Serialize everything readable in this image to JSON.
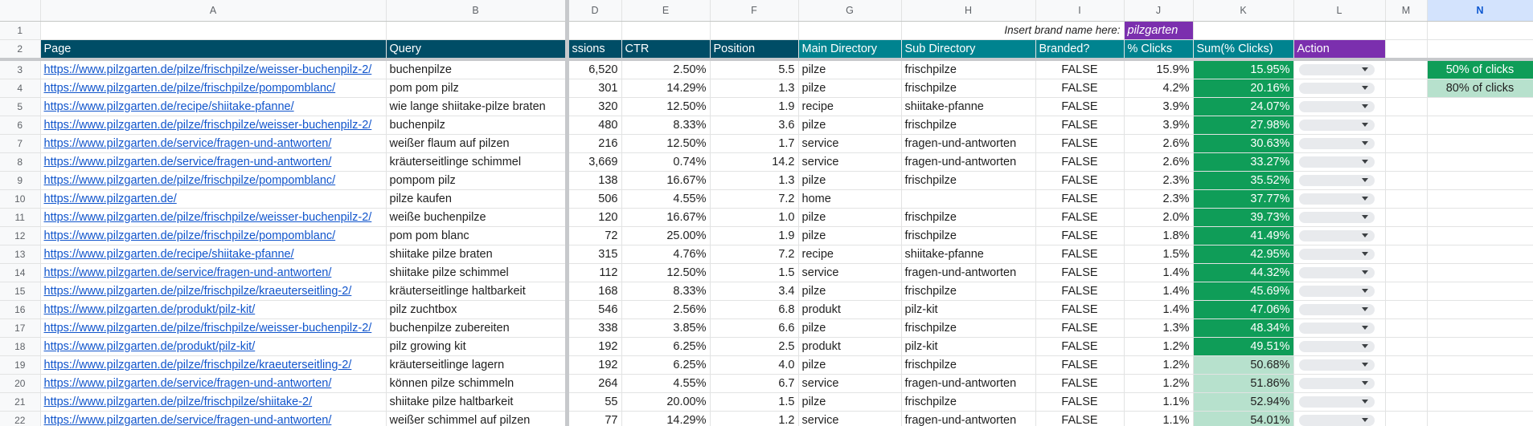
{
  "columns": [
    "",
    "A",
    "B",
    "D",
    "E",
    "F",
    "G",
    "H",
    "I",
    "J",
    "K",
    "L",
    "M",
    "N"
  ],
  "selected_column": "N",
  "row1": {
    "row_number": "1",
    "brand_prompt": "Insert brand name here:",
    "brand_value": "pilzgarten"
  },
  "headers": {
    "row_number": "2",
    "page": "Page",
    "query": "Query",
    "impressions": "ssions",
    "ctr": "CTR",
    "position": "Position",
    "main_directory": "Main Directory",
    "sub_directory": "Sub Directory",
    "branded": "Branded?",
    "pct_clicks": "% Clicks",
    "sum_clicks": "Sum(% Clicks)",
    "action": "Action"
  },
  "legend": {
    "dark_label": "50% of clicks",
    "light_label": "80% of clicks",
    "dark_color": "#0f9d58",
    "light_color": "#b7e1cd"
  },
  "rows": [
    {
      "n": "3",
      "page": "https://www.pilzgarten.de/pilze/frischpilze/weisser-buchenpilz-2/",
      "query": "buchenpilze",
      "impressions": "6,520",
      "ctr": "2.50%",
      "position": "5.5",
      "main": "pilze",
      "sub": "frischpilze",
      "branded": "FALSE",
      "pct": "15.9%",
      "sum": "15.95%",
      "tier": "dark"
    },
    {
      "n": "4",
      "page": "https://www.pilzgarten.de/pilze/frischpilze/pompomblanc/",
      "query": "pom pom pilz",
      "impressions": "301",
      "ctr": "14.29%",
      "position": "1.3",
      "main": "pilze",
      "sub": "frischpilze",
      "branded": "FALSE",
      "pct": "4.2%",
      "sum": "20.16%",
      "tier": "dark"
    },
    {
      "n": "5",
      "page": "https://www.pilzgarten.de/recipe/shiitake-pfanne/",
      "query": "wie lange shiitake-pilze braten",
      "impressions": "320",
      "ctr": "12.50%",
      "position": "1.9",
      "main": "recipe",
      "sub": "shiitake-pfanne",
      "branded": "FALSE",
      "pct": "3.9%",
      "sum": "24.07%",
      "tier": "dark"
    },
    {
      "n": "6",
      "page": "https://www.pilzgarten.de/pilze/frischpilze/weisser-buchenpilz-2/",
      "query": "buchenpilz",
      "impressions": "480",
      "ctr": "8.33%",
      "position": "3.6",
      "main": "pilze",
      "sub": "frischpilze",
      "branded": "FALSE",
      "pct": "3.9%",
      "sum": "27.98%",
      "tier": "dark"
    },
    {
      "n": "7",
      "page": "https://www.pilzgarten.de/service/fragen-und-antworten/",
      "query": "weißer flaum auf pilzen",
      "impressions": "216",
      "ctr": "12.50%",
      "position": "1.7",
      "main": "service",
      "sub": "fragen-und-antworten",
      "branded": "FALSE",
      "pct": "2.6%",
      "sum": "30.63%",
      "tier": "dark"
    },
    {
      "n": "8",
      "page": "https://www.pilzgarten.de/service/fragen-und-antworten/",
      "query": "kräuterseitlinge schimmel",
      "impressions": "3,669",
      "ctr": "0.74%",
      "position": "14.2",
      "main": "service",
      "sub": "fragen-und-antworten",
      "branded": "FALSE",
      "pct": "2.6%",
      "sum": "33.27%",
      "tier": "dark"
    },
    {
      "n": "9",
      "page": "https://www.pilzgarten.de/pilze/frischpilze/pompomblanc/",
      "query": "pompom pilz",
      "impressions": "138",
      "ctr": "16.67%",
      "position": "1.3",
      "main": "pilze",
      "sub": "frischpilze",
      "branded": "FALSE",
      "pct": "2.3%",
      "sum": "35.52%",
      "tier": "dark"
    },
    {
      "n": "10",
      "page": "https://www.pilzgarten.de/",
      "query": "pilze kaufen",
      "impressions": "506",
      "ctr": "4.55%",
      "position": "7.2",
      "main": "home",
      "sub": "",
      "branded": "FALSE",
      "pct": "2.3%",
      "sum": "37.77%",
      "tier": "dark"
    },
    {
      "n": "11",
      "page": "https://www.pilzgarten.de/pilze/frischpilze/weisser-buchenpilz-2/",
      "query": "weiße buchenpilze",
      "impressions": "120",
      "ctr": "16.67%",
      "position": "1.0",
      "main": "pilze",
      "sub": "frischpilze",
      "branded": "FALSE",
      "pct": "2.0%",
      "sum": "39.73%",
      "tier": "dark"
    },
    {
      "n": "12",
      "page": "https://www.pilzgarten.de/pilze/frischpilze/pompomblanc/",
      "query": "pom pom blanc",
      "impressions": "72",
      "ctr": "25.00%",
      "position": "1.9",
      "main": "pilze",
      "sub": "frischpilze",
      "branded": "FALSE",
      "pct": "1.8%",
      "sum": "41.49%",
      "tier": "dark"
    },
    {
      "n": "13",
      "page": "https://www.pilzgarten.de/recipe/shiitake-pfanne/",
      "query": "shiitake pilze braten",
      "impressions": "315",
      "ctr": "4.76%",
      "position": "7.2",
      "main": "recipe",
      "sub": "shiitake-pfanne",
      "branded": "FALSE",
      "pct": "1.5%",
      "sum": "42.95%",
      "tier": "dark"
    },
    {
      "n": "14",
      "page": "https://www.pilzgarten.de/service/fragen-und-antworten/",
      "query": "shiitake pilze schimmel",
      "impressions": "112",
      "ctr": "12.50%",
      "position": "1.5",
      "main": "service",
      "sub": "fragen-und-antworten",
      "branded": "FALSE",
      "pct": "1.4%",
      "sum": "44.32%",
      "tier": "dark"
    },
    {
      "n": "15",
      "page": "https://www.pilzgarten.de/pilze/frischpilze/kraeuterseitling-2/",
      "query": "kräuterseitlinge haltbarkeit",
      "impressions": "168",
      "ctr": "8.33%",
      "position": "3.4",
      "main": "pilze",
      "sub": "frischpilze",
      "branded": "FALSE",
      "pct": "1.4%",
      "sum": "45.69%",
      "tier": "dark"
    },
    {
      "n": "16",
      "page": "https://www.pilzgarten.de/produkt/pilz-kit/",
      "query": "pilz zuchtbox",
      "impressions": "546",
      "ctr": "2.56%",
      "position": "6.8",
      "main": "produkt",
      "sub": "pilz-kit",
      "branded": "FALSE",
      "pct": "1.4%",
      "sum": "47.06%",
      "tier": "dark"
    },
    {
      "n": "17",
      "page": "https://www.pilzgarten.de/pilze/frischpilze/weisser-buchenpilz-2/",
      "query": "buchenpilze zubereiten",
      "impressions": "338",
      "ctr": "3.85%",
      "position": "6.6",
      "main": "pilze",
      "sub": "frischpilze",
      "branded": "FALSE",
      "pct": "1.3%",
      "sum": "48.34%",
      "tier": "dark"
    },
    {
      "n": "18",
      "page": "https://www.pilzgarten.de/produkt/pilz-kit/",
      "query": "pilz growing kit",
      "impressions": "192",
      "ctr": "6.25%",
      "position": "2.5",
      "main": "produkt",
      "sub": "pilz-kit",
      "branded": "FALSE",
      "pct": "1.2%",
      "sum": "49.51%",
      "tier": "dark"
    },
    {
      "n": "19",
      "page": "https://www.pilzgarten.de/pilze/frischpilze/kraeuterseitling-2/",
      "query": "kräuterseitlinge lagern",
      "impressions": "192",
      "ctr": "6.25%",
      "position": "4.0",
      "main": "pilze",
      "sub": "frischpilze",
      "branded": "FALSE",
      "pct": "1.2%",
      "sum": "50.68%",
      "tier": "light"
    },
    {
      "n": "20",
      "page": "https://www.pilzgarten.de/service/fragen-und-antworten/",
      "query": "können pilze schimmeln",
      "impressions": "264",
      "ctr": "4.55%",
      "position": "6.7",
      "main": "service",
      "sub": "fragen-und-antworten",
      "branded": "FALSE",
      "pct": "1.2%",
      "sum": "51.86%",
      "tier": "light"
    },
    {
      "n": "21",
      "page": "https://www.pilzgarten.de/pilze/frischpilze/shiitake-2/",
      "query": "shiitake pilze haltbarkeit",
      "impressions": "55",
      "ctr": "20.00%",
      "position": "1.5",
      "main": "pilze",
      "sub": "frischpilze",
      "branded": "FALSE",
      "pct": "1.1%",
      "sum": "52.94%",
      "tier": "light"
    },
    {
      "n": "22",
      "page": "https://www.pilzgarten.de/service/fragen-und-antworten/",
      "query": "weißer schimmel auf pilzen",
      "impressions": "77",
      "ctr": "14.29%",
      "position": "1.2",
      "main": "service",
      "sub": "fragen-und-antworten",
      "branded": "FALSE",
      "pct": "1.1%",
      "sum": "54.01%",
      "tier": "light"
    }
  ]
}
